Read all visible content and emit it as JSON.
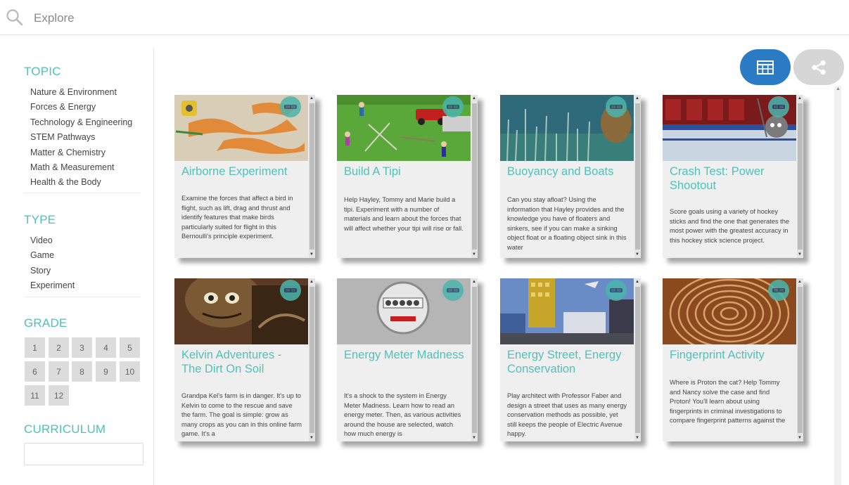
{
  "search": {
    "placeholder": "Explore"
  },
  "sidebar": {
    "topic": {
      "heading": "TOPIC",
      "items": [
        "Nature & Environment",
        "Forces & Energy",
        "Technology & Engineering",
        "STEM Pathways",
        "Matter & Chemistry",
        "Math & Measurement",
        "Health & the Body"
      ]
    },
    "type": {
      "heading": "TYPE",
      "items": [
        "Video",
        "Game",
        "Story",
        "Experiment"
      ]
    },
    "grade": {
      "heading": "GRADE",
      "items": [
        "1",
        "2",
        "3",
        "4",
        "5",
        "6",
        "7",
        "8",
        "9",
        "10",
        "11",
        "12"
      ]
    },
    "curriculum": {
      "heading": "CURRICULUM",
      "value": ""
    }
  },
  "toolbar": {
    "grid_view_icon": "grid-icon",
    "share_icon": "share-icon"
  },
  "cards": [
    {
      "title": "Airborne Experiment",
      "description": "Examine the forces that affect a bird in flight, such as lift, drag and thrust and identify features that make birds particularly suited for flight in this Bernoulli's principle experiment.",
      "badge_icon": "vr-goggles-icon"
    },
    {
      "title": "Build A Tipi",
      "description": "Help Hayley, Tommy and Marie build a tipi. Experiment with a number of materials and learn about the forces that will affect whether your tipi will rise or fall.",
      "badge_icon": "vr-goggles-icon"
    },
    {
      "title": "Buoyancy and Boats",
      "description": "Can you stay afloat? Using the information that Hayley provides and the knowledge you have of floaters and sinkers, see if you can make a sinking object float or a floating object sink in this water",
      "badge_icon": "vr-goggles-icon"
    },
    {
      "title": "Crash Test: Power Shootout",
      "description": "Score goals using a variety of hockey sticks and find the one that generates the most power with the greatest accuracy in this hockey stick science project.",
      "badge_icon": "vr-goggles-icon"
    },
    {
      "title": "Kelvin Adventures - The Dirt On Soil",
      "description": "Grandpa Kel's farm is in danger. It's up to Kelvin to come to the rescue and save the farm. The goal is simple: grow as many crops as you can in this online farm game. It's a",
      "badge_icon": "vr-goggles-icon"
    },
    {
      "title": "Energy Meter Madness",
      "description": "It's a shock to the system in Energy Meter Madness. Learn how to read an energy meter. Then, as various activities around the house are selected, watch how much energy is",
      "badge_icon": "vr-goggles-icon"
    },
    {
      "title": "Energy Street, Energy Conservation",
      "description": "Play architect with Professor Faber and design a street that uses as many energy conservation methods as possible, yet still keeps the people of Electric Avenue happy.",
      "badge_icon": "vr-goggles-icon"
    },
    {
      "title": "Fingerprint Activity",
      "description": "Where is Proton the cat? Help Tommy and Nancy solve the case and find Proton! You'll learn about using fingerprints in criminal investigations to compare fingerprint patterns against the",
      "badge_icon": "vr-goggles-icon"
    }
  ],
  "colors": {
    "accent": "#4ec2b8",
    "primary_button": "#2a7ac4",
    "secondary_button": "#d6d6d6"
  }
}
